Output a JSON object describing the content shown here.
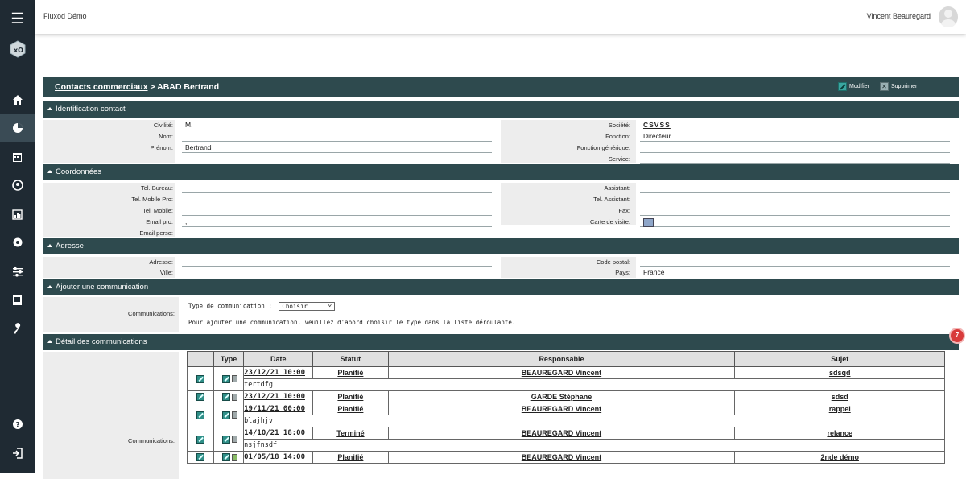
{
  "app": {
    "title": "Fluxod Démo",
    "user_name": "Vincent Beauregard",
    "notification_count": "7"
  },
  "sidebar": {
    "items": [
      {
        "name": "menu-icon",
        "glyph": "☰"
      },
      {
        "name": "logo-icon",
        "glyph": "⬢"
      },
      {
        "name": "home-icon",
        "glyph": "⌂"
      },
      {
        "name": "pie-chart-icon",
        "glyph": "◔"
      },
      {
        "name": "calendar-icon",
        "glyph": "▦"
      },
      {
        "name": "user-circle-icon",
        "glyph": "◉"
      },
      {
        "name": "bar-chart-icon",
        "glyph": "▥"
      },
      {
        "name": "gear-icon",
        "glyph": "✹"
      },
      {
        "name": "sliders-icon",
        "glyph": "☷"
      },
      {
        "name": "book-icon",
        "glyph": "▣"
      },
      {
        "name": "wrench-icon",
        "glyph": "✎"
      },
      {
        "name": "help-icon",
        "glyph": "?"
      },
      {
        "name": "logout-icon",
        "glyph": "⇥"
      }
    ]
  },
  "header": {
    "breadcrumb_link": "Contacts commerciaux",
    "breadcrumb_sep": " > ",
    "breadcrumb_current": "ABAD Bertrand",
    "modify_label": "Modifier",
    "delete_label": "Supprimer"
  },
  "sections": {
    "identification": "Identification contact",
    "coordonnees": "Coordonnées",
    "adresse": "Adresse",
    "ajouter_comm": "Ajouter une communication",
    "detail_comm": "Détail des communications"
  },
  "identification": {
    "left": [
      {
        "label": "Civilité:",
        "value": "M."
      },
      {
        "label": "Nom:",
        "value": ""
      },
      {
        "label": "Prénom:",
        "value": "Bertrand"
      }
    ],
    "right": [
      {
        "label": "Société:",
        "value": "CSVSS"
      },
      {
        "label": "Fonction:",
        "value": "Directeur"
      },
      {
        "label": "Fonction générique:",
        "value": ""
      },
      {
        "label": "Service:",
        "value": ""
      }
    ]
  },
  "coordonnees": {
    "left": [
      {
        "label": "Tel. Bureau:",
        "value": ""
      },
      {
        "label": "Tel. Mobile Pro:",
        "value": ""
      },
      {
        "label": "Tel. Mobile:",
        "value": ""
      },
      {
        "label": "Email pro:",
        "value": ","
      },
      {
        "label": "Email perso:",
        "value": ""
      }
    ],
    "right": [
      {
        "label": "Assistant:",
        "value": ""
      },
      {
        "label": "Tel. Assistant:",
        "value": ""
      },
      {
        "label": "Fax:",
        "value": ""
      },
      {
        "label": "Carte de visite:",
        "value": ""
      }
    ]
  },
  "adresse": {
    "left": [
      {
        "label": "Adresse:",
        "value": ""
      },
      {
        "label": "Ville:",
        "value": ""
      }
    ],
    "right": [
      {
        "label": "Code postal:",
        "value": ""
      },
      {
        "label": "Pays:",
        "value": "France"
      }
    ]
  },
  "ajout": {
    "label": "Communications:",
    "type_label": "Type de communication :",
    "select_value": "Choisir",
    "hint": "Pour ajouter une communication, veuillez d'abord choisir le type dans la liste déroulante."
  },
  "detail": {
    "label": "Communications:",
    "columns": [
      "Type",
      "Date",
      "Statut",
      "Responsable",
      "Sujet"
    ],
    "rows": [
      {
        "date": "23/12/21 10:00",
        "statut": "Planifié",
        "responsable": "BEAUREGARD Vincent",
        "sujet": "sdsqd",
        "note": "tertdfg",
        "icon": "phone"
      },
      {
        "date": "23/12/21 10:00",
        "statut": "Planifié",
        "responsable": "GARDE Stéphane",
        "sujet": "sdsd",
        "note": "",
        "icon": "phone"
      },
      {
        "date": "19/11/21 00:00",
        "statut": "Planifié",
        "responsable": "BEAUREGARD Vincent",
        "sujet": "rappel",
        "note": "blajhjv",
        "icon": "phone"
      },
      {
        "date": "14/10/21 18:00",
        "statut": "Terminé",
        "responsable": "BEAUREGARD Vincent",
        "sujet": "relance",
        "note": "nsjfnsdf",
        "icon": "phone"
      },
      {
        "date": "01/05/18 14:00",
        "statut": "Planifié",
        "responsable": "BEAUREGARD Vincent",
        "sujet": "2nde démo",
        "note": "",
        "icon": "calendar"
      }
    ]
  }
}
